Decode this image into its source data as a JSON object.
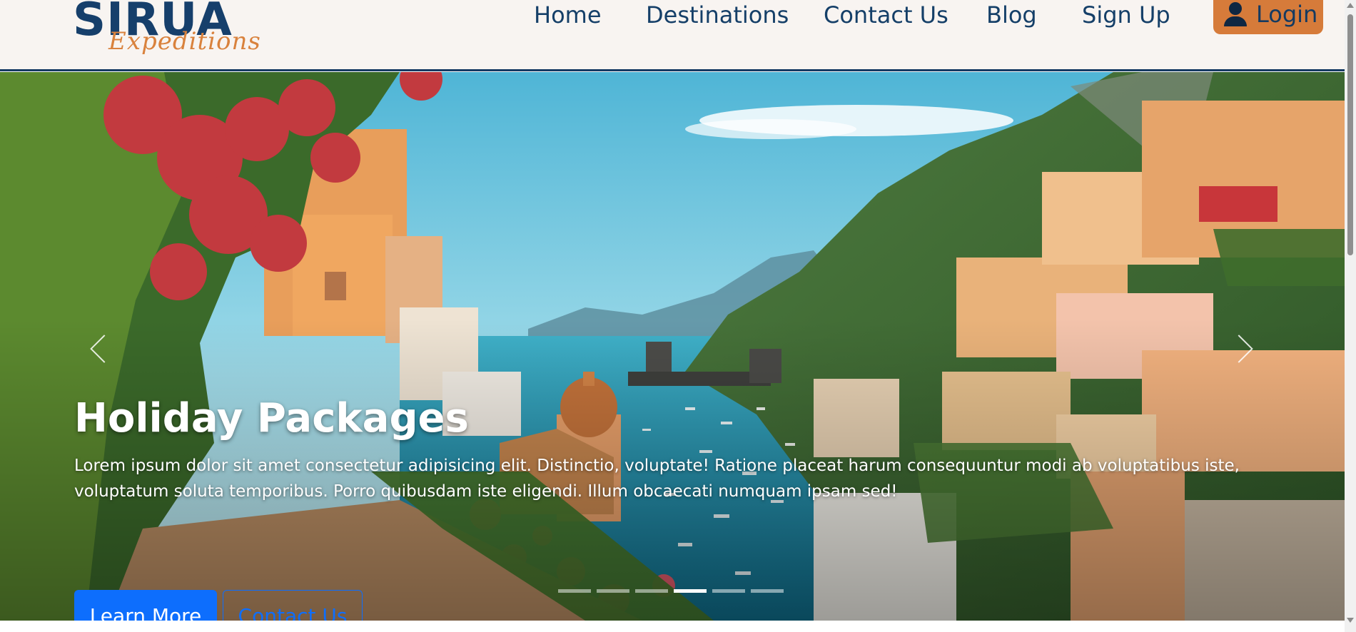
{
  "brand": {
    "name": "SIRUA",
    "tagline": "Expeditions"
  },
  "nav": {
    "items": [
      {
        "label": "Home"
      },
      {
        "label": "Destinations"
      },
      {
        "label": "Contact Us"
      },
      {
        "label": "Blog"
      },
      {
        "label": "Sign Up"
      }
    ],
    "login_label": "Login",
    "login_icon": "user-icon"
  },
  "hero": {
    "title": "Holiday Packages",
    "text": "Lorem ipsum dolor sit amet consectetur adipisicing elit. Distinctio, voluptate! Ratione placeat harum consequuntur modi ab voluptatibus iste, voluptatum soluta temporibus. Porro quibusdam iste eligendi. Illum obcaecati numquam ipsam sed!",
    "primary_button": "Learn More",
    "secondary_button": "Contact Us",
    "slide_count": 6,
    "active_slide": 4,
    "prev_icon": "chevron-left-icon",
    "next_icon": "chevron-right-icon"
  },
  "colors": {
    "navbar_bg": "#f8f4f1",
    "brand_blue": "#163f6b",
    "accent_orange": "#d67b3a",
    "button_blue": "#0d6efd"
  }
}
